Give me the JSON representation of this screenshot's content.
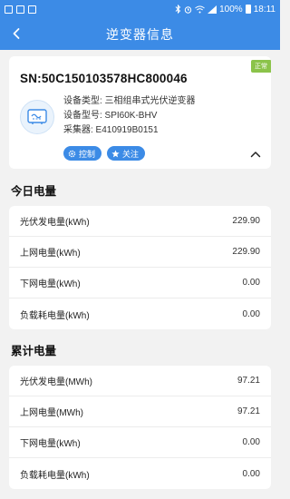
{
  "status_bar": {
    "time": "18:11",
    "battery": "100%"
  },
  "header": {
    "title": "逆变器信息"
  },
  "device": {
    "sn": "SN:50C150103578HC800046",
    "status_tag": "正常",
    "type_line": "设备类型: 三相组串式光伏逆变器",
    "model_line": "设备型号: SPI60K-BHV",
    "collector_line": "采集器: E410919B0151",
    "control_label": "控制",
    "follow_label": "关注"
  },
  "today": {
    "title": "今日电量",
    "rows": [
      {
        "label": "光伏发电量(kWh)",
        "value": "229.90"
      },
      {
        "label": "上网电量(kWh)",
        "value": "229.90"
      },
      {
        "label": "下网电量(kWh)",
        "value": "0.00"
      },
      {
        "label": "负载耗电量(kWh)",
        "value": "0.00"
      }
    ]
  },
  "total": {
    "title": "累计电量",
    "rows": [
      {
        "label": "光伏发电量(MWh)",
        "value": "97.21"
      },
      {
        "label": "上网电量(MWh)",
        "value": "97.21"
      },
      {
        "label": "下网电量(kWh)",
        "value": "0.00"
      },
      {
        "label": "负载耗电量(kWh)",
        "value": "0.00"
      }
    ]
  },
  "colors": {
    "primary": "#3c8be6",
    "status_ok": "#8bc34a",
    "background": "#f2f2f2"
  }
}
